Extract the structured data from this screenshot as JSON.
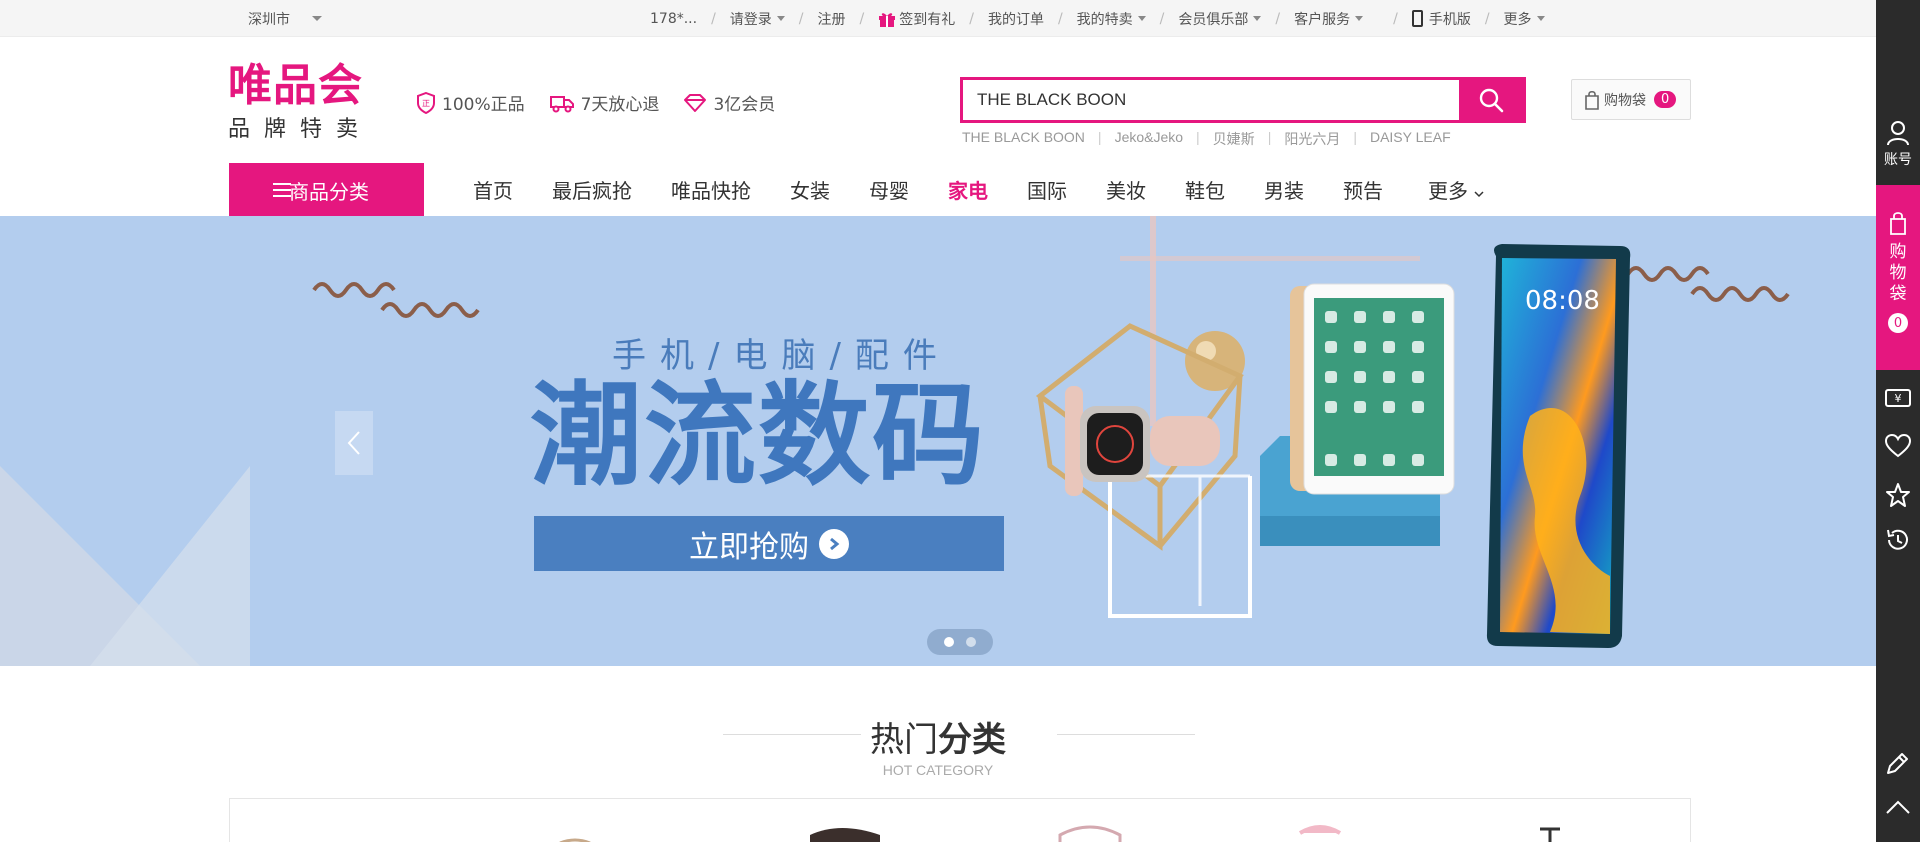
{
  "topbar": {
    "city": "深圳市",
    "user": "178*...",
    "login": "请登录",
    "register": "注册",
    "checkin": "签到有礼",
    "orders": "我的订单",
    "special": "我的特卖",
    "club": "会员俱乐部",
    "service": "客户服务",
    "mobile": "手机版",
    "more": "更多",
    "separator": "/"
  },
  "logo": {
    "main": "唯品会",
    "sub": "品牌特卖"
  },
  "promises": [
    {
      "icon": "shield-icon",
      "label": "100%正品"
    },
    {
      "icon": "truck-icon",
      "label": "7天放心退"
    },
    {
      "icon": "diamond-icon",
      "label": "3亿会员"
    }
  ],
  "search": {
    "value": "THE BLACK BOON",
    "hotwords": [
      "THE BLACK BOON",
      "Jeko&Jeko",
      "贝婕斯",
      "阳光六月",
      "DAISY LEAF"
    ],
    "hotword_separator": "|"
  },
  "cart": {
    "label": "购物袋",
    "count": "0"
  },
  "nav": {
    "category_button": "商品分类",
    "items": [
      "首页",
      "最后疯抢",
      "唯品快抢",
      "女装",
      "母婴",
      "家电",
      "国际",
      "美妆",
      "鞋包",
      "男装",
      "预告",
      "更多"
    ],
    "active_index": 5
  },
  "banner": {
    "subtitle": "手机/电脑/配件",
    "title": "潮流数码",
    "cta": "立即抢购",
    "watch_time": "08:08",
    "slides": 2,
    "active_slide": 0
  },
  "hot_category": {
    "title_light": "热门",
    "title_bold": "分类",
    "subtitle": "HOT CATEGORY"
  },
  "right_sidebar": {
    "account": "账号",
    "cart_chars": [
      "购",
      "物",
      "袋"
    ],
    "cart_count": "0",
    "icons": [
      "coupon-icon",
      "heart-icon",
      "star-icon",
      "history-icon",
      "edit-icon",
      "back-to-top-icon"
    ]
  },
  "colors": {
    "brand": "#e5177f",
    "banner_bg": "#b3cdee",
    "banner_text": "#3f77be",
    "sidebar": "#2b2b2b"
  }
}
